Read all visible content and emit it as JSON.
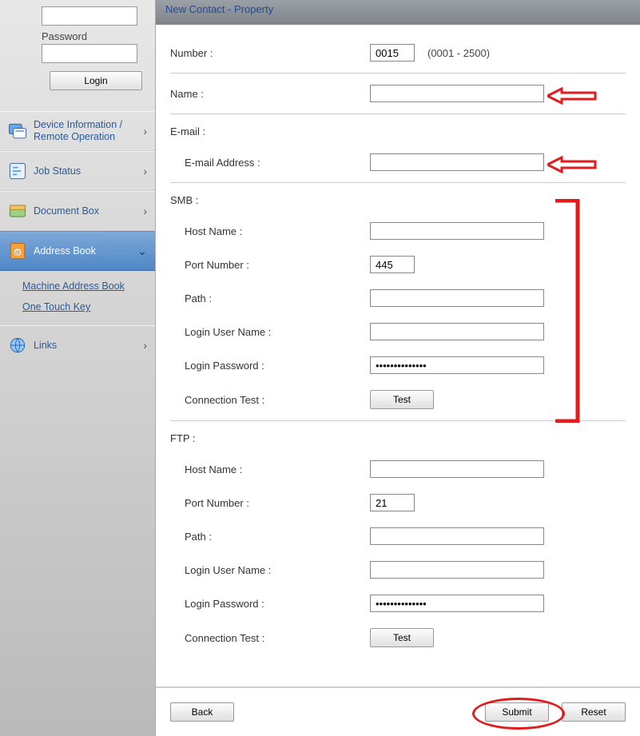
{
  "login": {
    "password_label": "Password",
    "button": "Login"
  },
  "nav": {
    "device_info": "Device Information / Remote Operation",
    "job_status": "Job Status",
    "document_box": "Document Box",
    "address_book": "Address Book",
    "links": "Links",
    "sub": {
      "machine_ab": "Machine Address Book",
      "one_touch": "One Touch Key"
    }
  },
  "title": "New Contact - Property",
  "form": {
    "number_label": "Number :",
    "number_value": "0015",
    "number_range": "(0001 - 2500)",
    "name_label": "Name :",
    "name_value": "",
    "email_section": "E-mail :",
    "email_addr_label": "E-mail Address :",
    "email_addr_value": "",
    "smb_section": "SMB :",
    "smb_host_label": "Host Name :",
    "smb_host_value": "",
    "smb_port_label": "Port Number :",
    "smb_port_value": "445",
    "smb_path_label": "Path :",
    "smb_path_value": "",
    "smb_user_label": "Login User Name :",
    "smb_user_value": "",
    "smb_pw_label": "Login Password :",
    "smb_pw_value": "••••••••••••••",
    "smb_conn_label": "Connection Test :",
    "ftp_section": "FTP :",
    "ftp_host_label": "Host Name :",
    "ftp_host_value": "",
    "ftp_port_label": "Port Number :",
    "ftp_port_value": "21",
    "ftp_path_label": "Path :",
    "ftp_path_value": "",
    "ftp_user_label": "Login User Name :",
    "ftp_user_value": "",
    "ftp_pw_label": "Login Password :",
    "ftp_pw_value": "••••••••••••••",
    "ftp_conn_label": "Connection Test :",
    "test_btn": "Test"
  },
  "footer": {
    "back": "Back",
    "submit": "Submit",
    "reset": "Reset"
  }
}
